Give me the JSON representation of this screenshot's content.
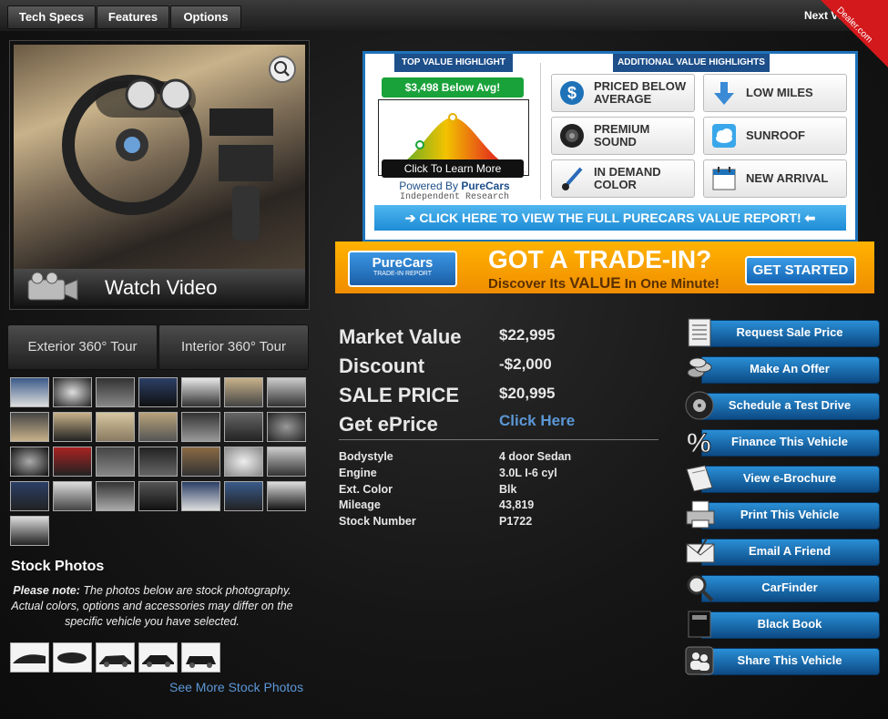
{
  "topbar": {
    "tabs": [
      "Tech Specs",
      "Features",
      "Options"
    ],
    "next_label": "Next Vehi",
    "dealer_badge": "Dealer.com"
  },
  "media": {
    "watch_video": "Watch Video",
    "exterior_tour": "Exterior 360° Tour",
    "interior_tour": "Interior 360° Tour"
  },
  "stock": {
    "title": "Stock Photos",
    "note_bold": "Please note:",
    "note_text": "The photos below are stock photography. Actual colors, options and accessories may differ on the specific vehicle you have selected.",
    "see_more": "See More Stock Photos"
  },
  "purecars": {
    "top_header": "TOP VALUE HIGHLIGHT",
    "additional_header": "ADDITIONAL VALUE HIGHLIGHTS",
    "below_avg": "$3,498 Below Avg!",
    "learn_more": "Click To Learn More",
    "powered_prefix": "Powered By",
    "powered_brand": "PureCars",
    "independent": "Independent Research",
    "highlights": [
      {
        "label": "PRICED BELOW AVERAGE",
        "icon": "dollar-icon"
      },
      {
        "label": "LOW MILES",
        "icon": "down-arrow-icon"
      },
      {
        "label": "PREMIUM SOUND",
        "icon": "speaker-icon"
      },
      {
        "label": "SUNROOF",
        "icon": "cloud-icon"
      },
      {
        "label": "IN DEMAND COLOR",
        "icon": "paintbrush-icon"
      },
      {
        "label": "NEW ARRIVAL",
        "icon": "calendar-icon"
      }
    ],
    "full_report": "➔ CLICK HERE TO VIEW THE FULL PURECARS VALUE REPORT! ⬅"
  },
  "trade_in": {
    "logo": "PureCars",
    "logo_sub": "TRADE-IN REPORT",
    "headline": "GOT A TRADE-IN?",
    "sub_pre": "Discover Its",
    "sub_bold": "VALUE",
    "sub_post": "In One Minute!",
    "button": "GET STARTED"
  },
  "pricing": {
    "market_label": "Market Value",
    "market_value": "$22,995",
    "discount_label": "Discount",
    "discount_value": "-$2,000",
    "sale_label": "SALE PRICE",
    "sale_value": "$20,995",
    "eprice_label": "Get ePrice",
    "eprice_link": "Click Here"
  },
  "specs": [
    {
      "label": "Bodystyle",
      "value": "4 door Sedan"
    },
    {
      "label": "Engine",
      "value": "3.0L I-6 cyl"
    },
    {
      "label": "Ext. Color",
      "value": "Blk"
    },
    {
      "label": "Mileage",
      "value": "43,819"
    },
    {
      "label": "Stock Number",
      "value": "P1722"
    }
  ],
  "actions": [
    {
      "label": "Request Sale Price",
      "icon": "price-sheet-icon"
    },
    {
      "label": "Make An Offer",
      "icon": "coins-icon"
    },
    {
      "label": "Schedule a Test Drive",
      "icon": "tire-icon"
    },
    {
      "label": "Finance This Vehicle",
      "icon": "percent-icon"
    },
    {
      "label": "View e-Brochure",
      "icon": "brochure-icon"
    },
    {
      "label": "Print This Vehicle",
      "icon": "printer-icon"
    },
    {
      "label": "Email A Friend",
      "icon": "envelope-icon"
    },
    {
      "label": "CarFinder",
      "icon": "magnifier-icon"
    },
    {
      "label": "Black Book",
      "icon": "black-book-icon"
    },
    {
      "label": "Share This Vehicle",
      "icon": "share-people-icon"
    }
  ],
  "colors": {
    "accent_blue": "#1e72b8",
    "link_blue": "#5b97d6",
    "trade_orange": "#f5a000",
    "dealer_red": "#d4191c"
  }
}
